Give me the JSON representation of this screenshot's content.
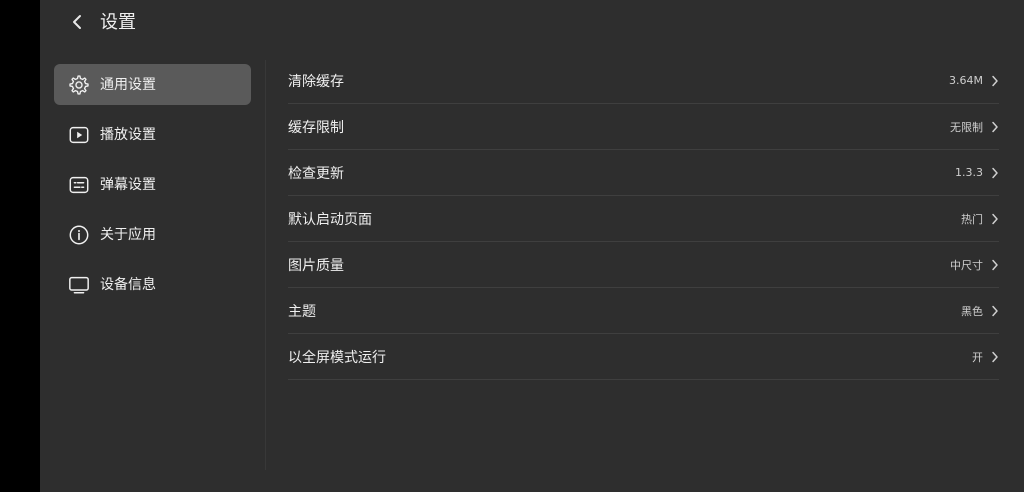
{
  "header": {
    "title": "设置"
  },
  "sidebar": {
    "items": [
      {
        "label": "通用设置",
        "icon": "gear-icon",
        "active": true
      },
      {
        "label": "播放设置",
        "icon": "play-icon",
        "active": false
      },
      {
        "label": "弹幕设置",
        "icon": "danmaku-icon",
        "active": false
      },
      {
        "label": "关于应用",
        "icon": "info-icon",
        "active": false
      },
      {
        "label": "设备信息",
        "icon": "monitor-icon",
        "active": false
      }
    ]
  },
  "settings": [
    {
      "label": "清除缓存",
      "value": "3.64M"
    },
    {
      "label": "缓存限制",
      "value": "无限制"
    },
    {
      "label": "检查更新",
      "value": "1.3.3"
    },
    {
      "label": "默认启动页面",
      "value": "热门"
    },
    {
      "label": "图片质量",
      "value": "中尺寸"
    },
    {
      "label": "主题",
      "value": "黑色"
    },
    {
      "label": "以全屏模式运行",
      "value": "开"
    }
  ],
  "colors": {
    "background": "#2e2e2e",
    "active_item": "#5a5a5a",
    "divider": "#3f3f3f",
    "text": "#efefef"
  }
}
